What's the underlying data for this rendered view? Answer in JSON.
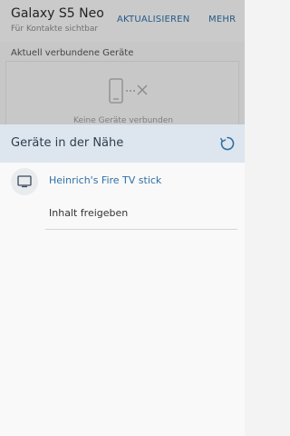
{
  "appbar": {
    "title": "Galaxy S5 Neo",
    "subtitle": "Für Kontakte sichtbar",
    "actions": {
      "update": "AKTUALISIEREN",
      "more": "MEHR"
    }
  },
  "connected": {
    "section_label": "Aktuell verbundene Geräte",
    "empty_text": "Keine Geräte verbunden"
  },
  "sheet": {
    "title": "Geräte in der Nähe",
    "devices": [
      {
        "name": "Heinrich's Fire TV stick",
        "icon": "tv-icon"
      }
    ],
    "share_label": "Inhalt freigeben"
  },
  "colors": {
    "accent": "#2f6fa6",
    "sheet_header": "#dde6ee"
  },
  "icons": [
    "phone-disconnected-icon",
    "refresh-icon",
    "tv-icon"
  ]
}
